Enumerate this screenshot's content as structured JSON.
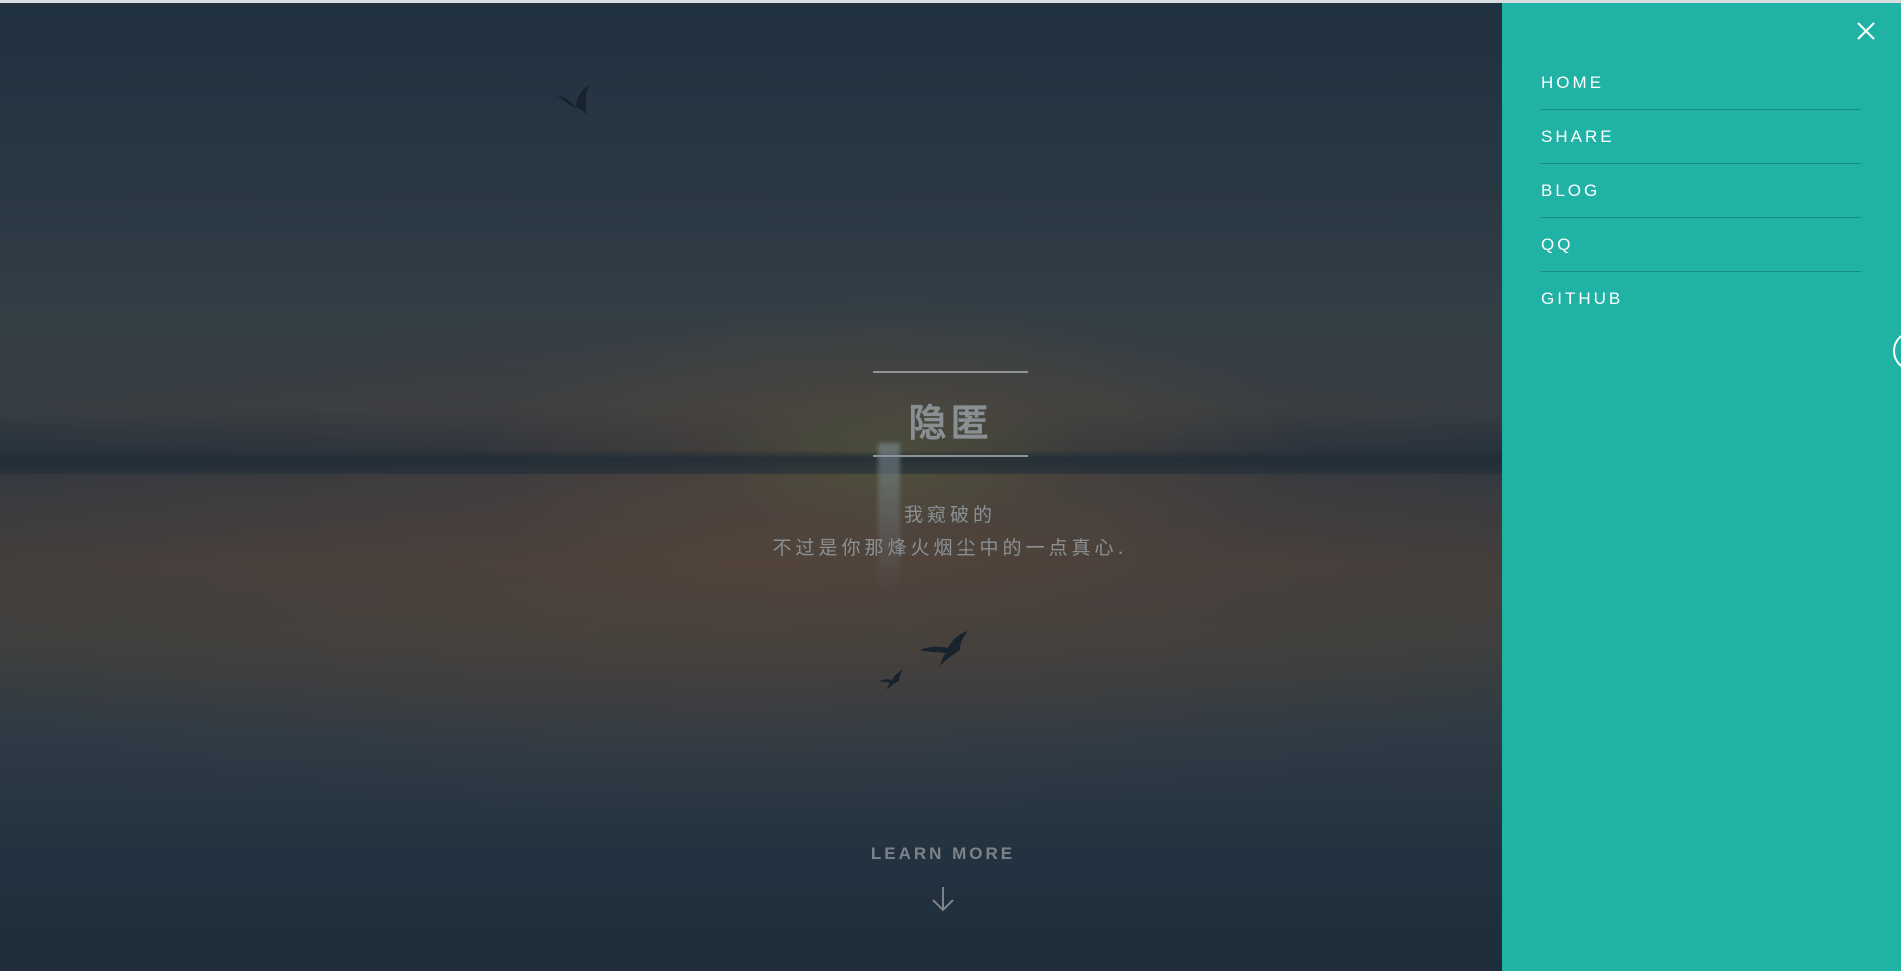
{
  "hero": {
    "title": "隐匿",
    "tagline_line1": "我窥破的",
    "tagline_line2": "不过是你那烽火烟尘中的一点真心.",
    "learn_more_label": "LEARN MORE",
    "arrow_icon": "arrow-down-icon"
  },
  "panel": {
    "background": "#20b2a5",
    "close_icon": "close-icon",
    "menu": [
      {
        "label": "HOME"
      },
      {
        "label": "SHARE"
      },
      {
        "label": "BLOG"
      },
      {
        "label": "QQ"
      },
      {
        "label": "GITHUB"
      }
    ]
  }
}
